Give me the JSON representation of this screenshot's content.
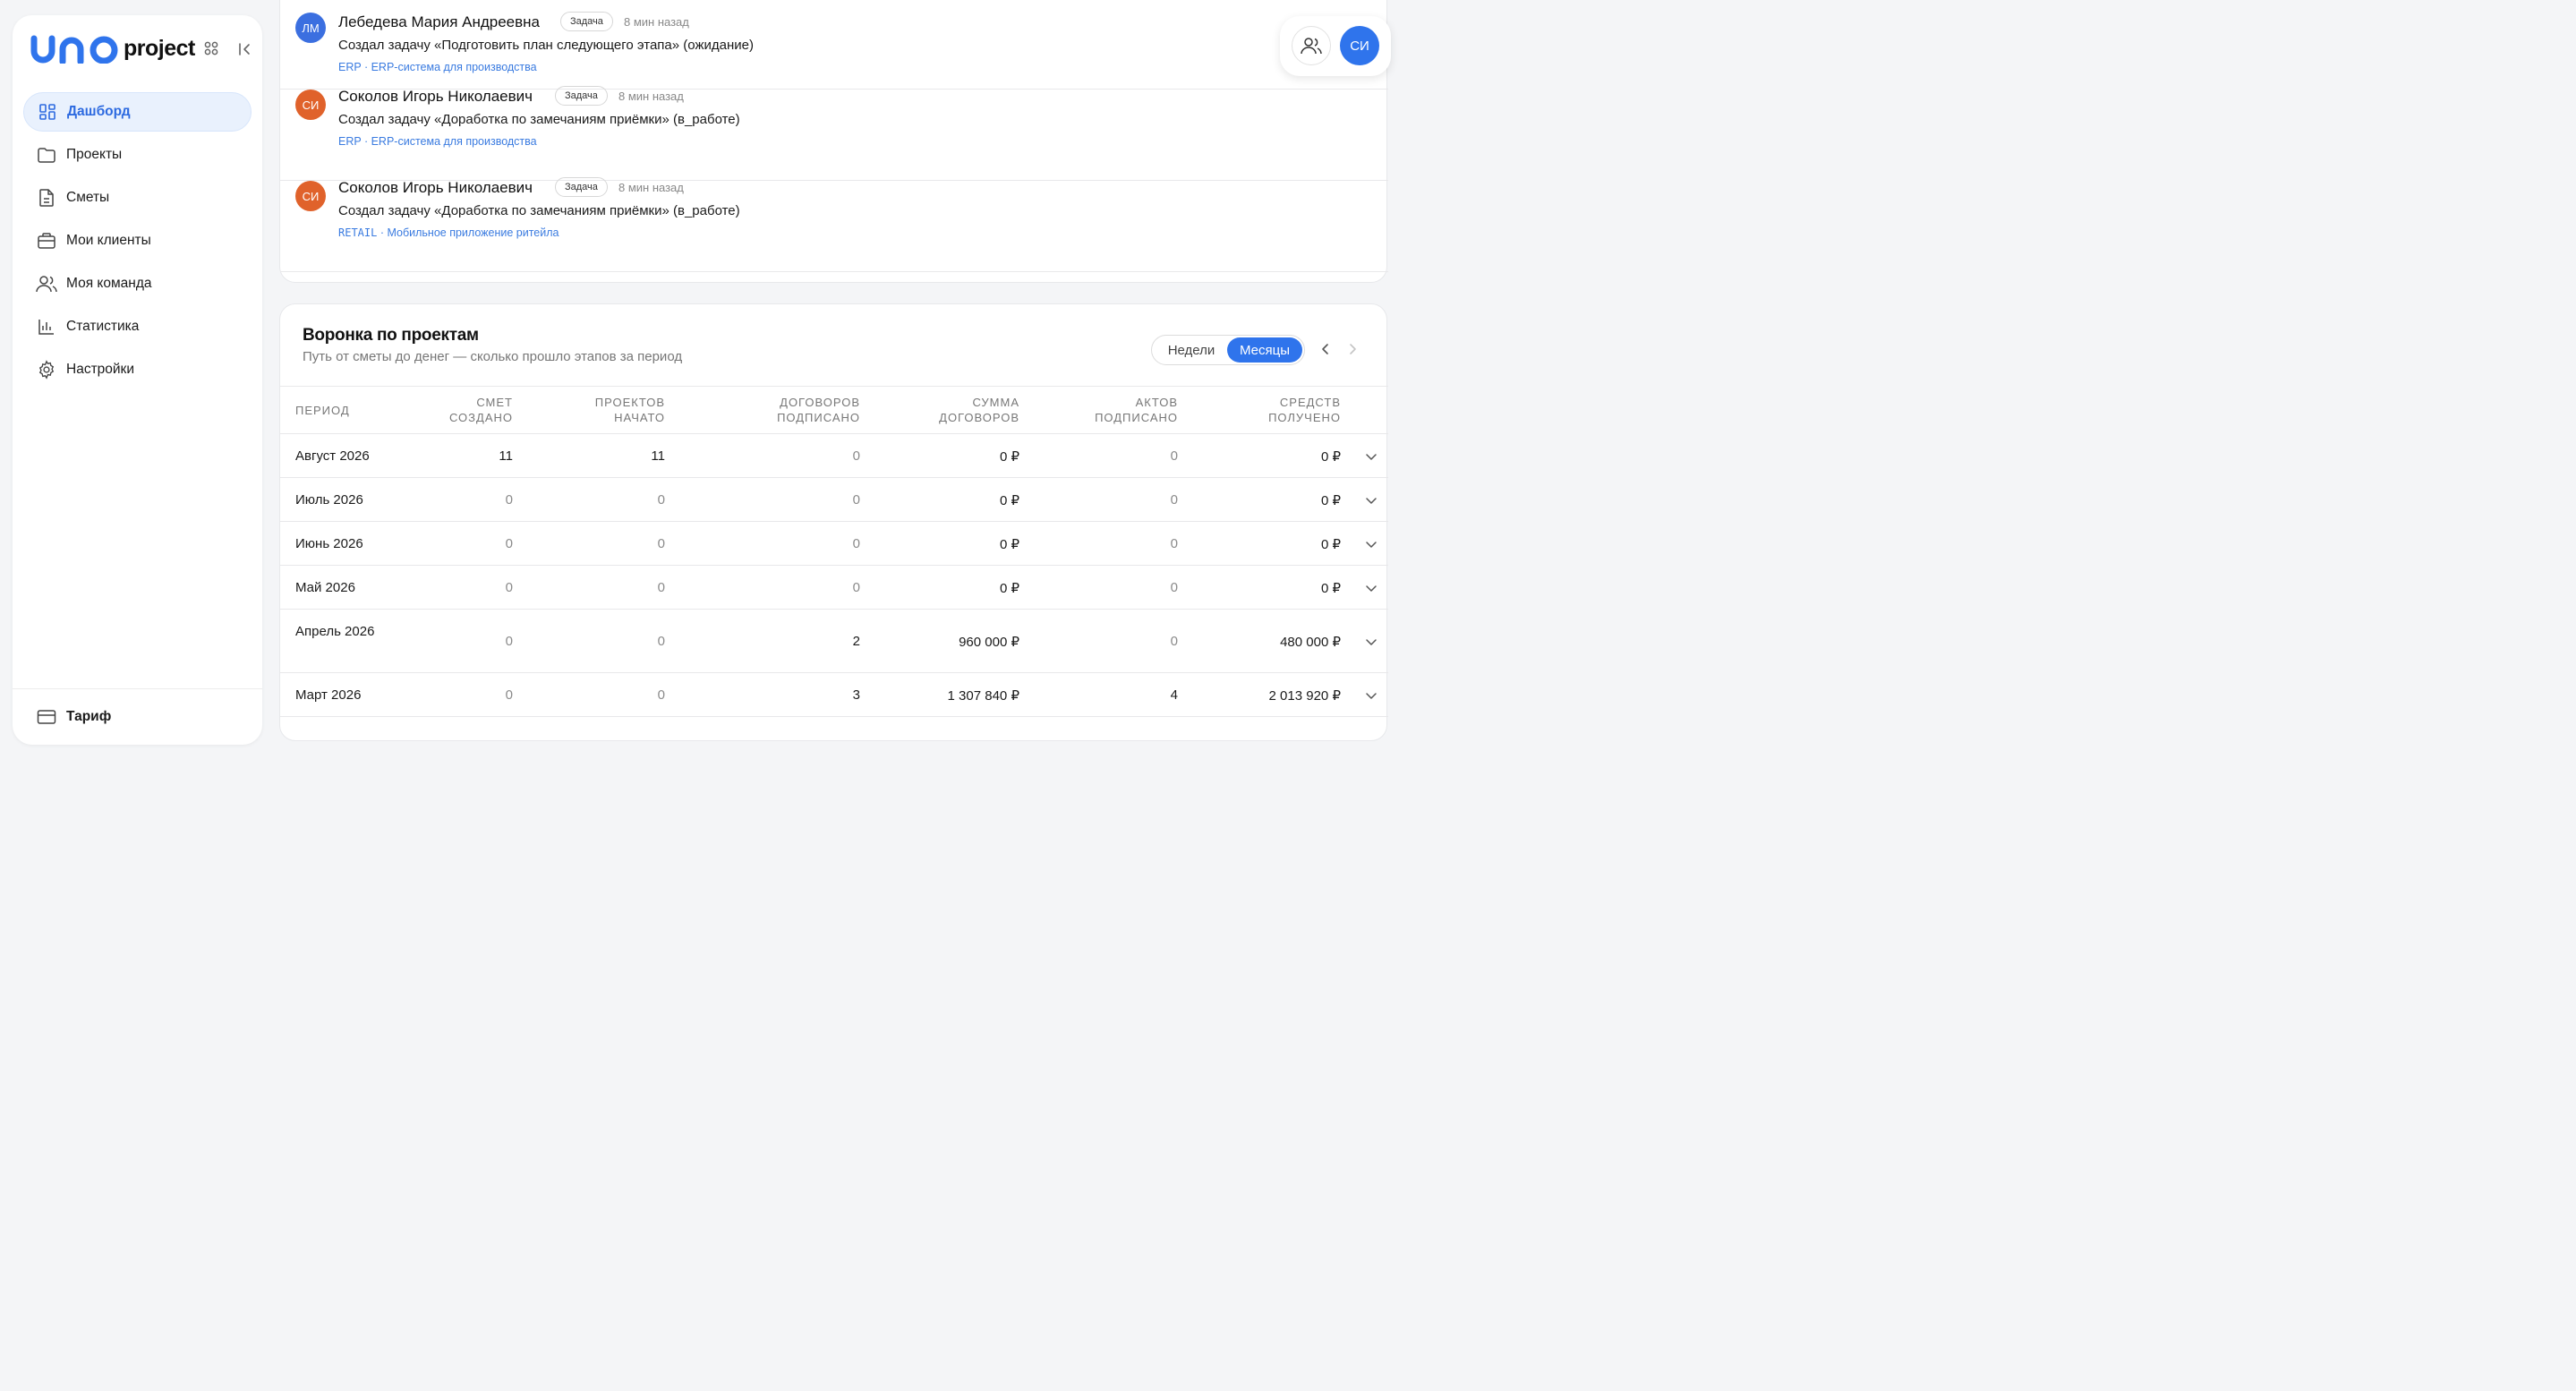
{
  "app": {
    "logo_main": "uno",
    "logo_sub": "project"
  },
  "sidebar": {
    "items": [
      {
        "label": "Дашборд",
        "icon": "dashboard-icon",
        "active": true
      },
      {
        "label": "Проекты",
        "icon": "folder-icon"
      },
      {
        "label": "Сметы",
        "icon": "document-icon"
      },
      {
        "label": "Мои клиенты",
        "icon": "briefcase-icon"
      },
      {
        "label": "Моя команда",
        "icon": "team-icon"
      },
      {
        "label": "Статистика",
        "icon": "chart-icon"
      },
      {
        "label": "Настройки",
        "icon": "gear-icon"
      }
    ],
    "tariff_label": "Тариф"
  },
  "activity": [
    {
      "initials": "ЛМ",
      "avatar_color": "#3b6fe0",
      "name": "Лебедева Мария Андреевна",
      "badge": "Задача",
      "time": "8 мин назад",
      "desc": "Создал задачу «Подготовить план следующего этапа» (ожидание)",
      "tag_code": "ERP",
      "tag_name": "ERP-система для производства"
    },
    {
      "initials": "СИ",
      "avatar_color": "#e0622b",
      "name": "Соколов Игорь Николаевич",
      "badge": "Задача",
      "time": "8 мин назад",
      "desc": "Создал задачу «Доработка по замечаниям приёмки» (в_работе)",
      "tag_code": "ERP",
      "tag_name": "ERP-система для производства"
    },
    {
      "initials": "СИ",
      "avatar_color": "#e0622b",
      "name": "Соколов Игорь Николаевич",
      "badge": "Задача",
      "time": "8 мин назад",
      "desc": "Создал задачу «Доработка по замечаниям приёмки» (в_работе)",
      "tag_code": "RETAIL",
      "tag_name": "Мобильное приложение ритейла"
    }
  ],
  "user": {
    "initials": "СИ"
  },
  "funnel": {
    "title": "Воронка по проектам",
    "subtitle": "Путь от сметы до денег — сколько прошло этапов за период",
    "toggle_weeks": "Недели",
    "toggle_months": "Месяцы",
    "toggle_active": "months",
    "columns": {
      "period": "Период",
      "estimates_1": "Смет",
      "estimates_2": "создано",
      "projects_1": "Проектов",
      "projects_2": "начато",
      "contracts_1": "Договоров",
      "contracts_2": "подписано",
      "sum_1": "Сумма",
      "sum_2": "договоров",
      "acts_1": "Актов",
      "acts_2": "подписано",
      "funds_1": "Средств",
      "funds_2": "получено"
    },
    "rows": [
      {
        "period": "Август 2026",
        "estimates": "11",
        "projects": "11",
        "contracts": "0",
        "sum": "0 ₽",
        "acts": "0",
        "funds": "0 ₽"
      },
      {
        "period": "Июль 2026",
        "estimates": "0",
        "projects": "0",
        "contracts": "0",
        "sum": "0 ₽",
        "acts": "0",
        "funds": "0 ₽"
      },
      {
        "period": "Июнь 2026",
        "estimates": "0",
        "projects": "0",
        "contracts": "0",
        "sum": "0 ₽",
        "acts": "0",
        "funds": "0 ₽"
      },
      {
        "period": "Май 2026",
        "estimates": "0",
        "projects": "0",
        "contracts": "0",
        "sum": "0 ₽",
        "acts": "0",
        "funds": "0 ₽"
      },
      {
        "period": "Апрель 2026",
        "estimates": "0",
        "projects": "0",
        "contracts": "2",
        "sum": "960 000 ₽",
        "acts": "0",
        "funds": "480 000 ₽"
      },
      {
        "period": "Март 2026",
        "estimates": "0",
        "projects": "0",
        "contracts": "3",
        "sum": "1 307 840 ₽",
        "acts": "4",
        "funds": "2 013 920 ₽"
      }
    ]
  },
  "colors": {
    "accent": "#2f74ec",
    "active_nav_bg": "#e9f1fd",
    "tag_link": "#3a7be0"
  }
}
